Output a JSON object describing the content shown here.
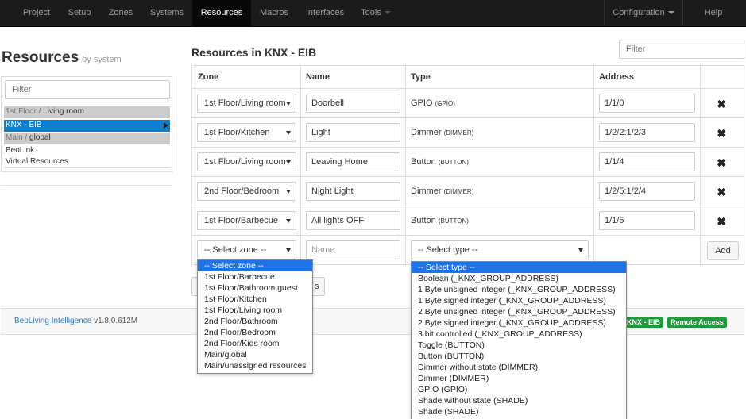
{
  "nav": {
    "items": [
      "Project",
      "Setup",
      "Zones",
      "Systems",
      "Resources",
      "Macros",
      "Interfaces",
      "Tools"
    ],
    "active": "Resources",
    "configuration": "Configuration",
    "help": "Help"
  },
  "left": {
    "title": "Resources",
    "subtitle": "by system",
    "filter_placeholder": "Filter",
    "items": [
      {
        "part1": "1st Floor / ",
        "part2": "Living room"
      },
      {
        "label": "KNX - EIB"
      },
      {
        "part1": "Main / ",
        "part2": "global"
      },
      {
        "label": "BeoLink"
      },
      {
        "label": "Virtual Resources"
      }
    ]
  },
  "main": {
    "title": "Resources in KNX - EIB",
    "filter_placeholder": "Filter",
    "headers": {
      "zone": "Zone",
      "name": "Name",
      "type": "Type",
      "address": "Address"
    },
    "rows": [
      {
        "zone": "1st Floor/Living room",
        "name": "Doorbell",
        "type": "GPIO",
        "code": "(GPIO)",
        "address": "1/1/0"
      },
      {
        "zone": "1st Floor/Kitchen",
        "name": "Light",
        "type": "Dimmer",
        "code": "(DIMMER)",
        "address": "1/2/2:1/2/3"
      },
      {
        "zone": "1st Floor/Living room",
        "name": "Leaving Home",
        "type": "Button",
        "code": "(BUTTON)",
        "address": "1/1/4"
      },
      {
        "zone": "2nd Floor/Bedroom",
        "name": "Night Light",
        "type": "Dimmer",
        "code": "(DIMMER)",
        "address": "1/2/5:1/2/4"
      },
      {
        "zone": "1st Floor/Barbecue",
        "name": "All lights OFF",
        "type": "Button",
        "code": "(BUTTON)",
        "address": "1/1/5"
      }
    ],
    "delete_glyph": "✖",
    "new_row": {
      "zone_placeholder": "-- Select zone --",
      "name_placeholder": "Name",
      "type_placeholder": "-- Select type --",
      "add_label": "Add"
    },
    "hidden_btn_tail": "s"
  },
  "zone_dropdown": {
    "options": [
      "-- Select zone --",
      "1st Floor/Barbecue",
      "1st Floor/Bathroom guest",
      "1st Floor/Kitchen",
      "1st Floor/Living room",
      "2nd Floor/Bathroom",
      "2nd Floor/Bedroom",
      "2nd Floor/Kids room",
      "Main/global",
      "Main/unassigned resources"
    ],
    "highlighted": 0
  },
  "type_dropdown": {
    "options": [
      "-- Select type --",
      "Boolean (_KNX_GROUP_ADDRESS)",
      "1 Byte unsigned integer (_KNX_GROUP_ADDRESS)",
      "1 Byte signed integer (_KNX_GROUP_ADDRESS)",
      "2 Byte unsigned integer (_KNX_GROUP_ADDRESS)",
      "2 Byte signed integer (_KNX_GROUP_ADDRESS)",
      "3 bit controlled (_KNX_GROUP_ADDRESS)",
      "Toggle (BUTTON)",
      "Button (BUTTON)",
      "Dimmer without state (DIMMER)",
      "Dimmer (DIMMER)",
      "GPIO (GPIO)",
      "Shade without state (SHADE)",
      "Shade (SHADE)"
    ],
    "highlighted": 0
  },
  "footer": {
    "app_name": "BeoLiving Intelligence",
    "version": "v1.8.0.612M",
    "badges": [
      "KNX - EIB",
      "Remote Access"
    ]
  },
  "colors": {
    "navbar": "#1b1b1b",
    "selected": "#0b7fcf",
    "highlight": "#1e73e8",
    "badge": "#1e9a3d"
  }
}
